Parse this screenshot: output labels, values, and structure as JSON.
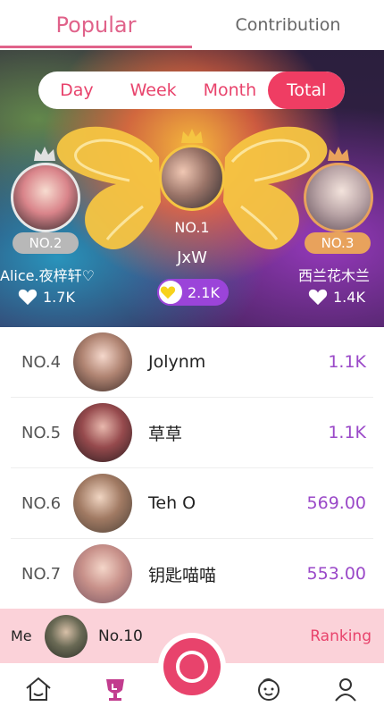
{
  "tabs": {
    "popular": "Popular",
    "contribution": "Contribution"
  },
  "periods": [
    "Day",
    "Week",
    "Month",
    "Total"
  ],
  "active_period": "Total",
  "podium": [
    {
      "rank": "NO.1",
      "name": "JxW",
      "likes": "2.1K"
    },
    {
      "rank": "NO.2",
      "name": "Alice.夜梓轩♡",
      "likes": "1.7K"
    },
    {
      "rank": "NO.3",
      "name": "西兰花木兰",
      "likes": "1.4K"
    }
  ],
  "list": [
    {
      "rank": "NO.4",
      "name": "Jolynm",
      "score": "1.1K"
    },
    {
      "rank": "NO.5",
      "name": "草草",
      "score": "1.1K"
    },
    {
      "rank": "NO.6",
      "name": "Teh O",
      "score": "569.00"
    },
    {
      "rank": "NO.7",
      "name": "钥匙喵喵",
      "score": "553.00"
    }
  ],
  "me": {
    "label": "Me",
    "rank": "No.10",
    "ranking_link": "Ranking"
  },
  "colors": {
    "accent": "#e8436c",
    "score": "#9a48c8",
    "gold": "#f5c542",
    "silver": "#b8b8b8",
    "bronze": "#e8a25c"
  },
  "icons": {
    "nav": [
      "home-icon",
      "trophy-icon",
      "live-ring-icon",
      "baby-face-icon",
      "profile-icon"
    ]
  }
}
